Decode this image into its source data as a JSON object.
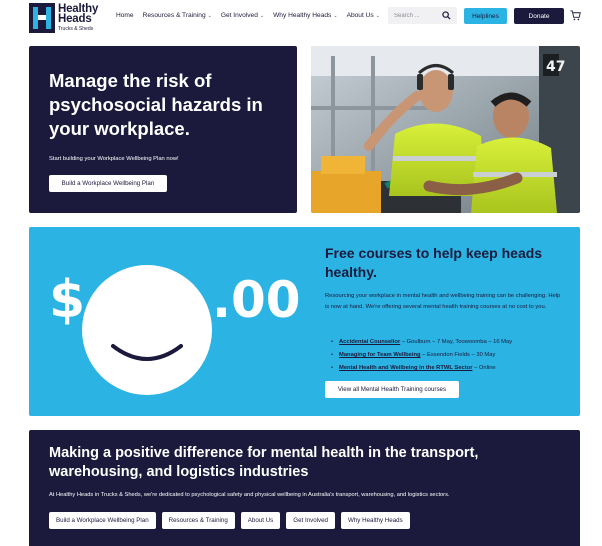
{
  "brand": {
    "name_line1": "Healthy",
    "name_line2": "Heads",
    "tagline": "Trucks & Sheds",
    "colors": {
      "navy": "#1b1a3c",
      "cyan": "#2bb3e3",
      "white": "#ffffff"
    }
  },
  "nav": {
    "items": [
      {
        "label": "Home",
        "has_dropdown": false
      },
      {
        "label": "Resources & Training",
        "has_dropdown": true
      },
      {
        "label": "Get Involved",
        "has_dropdown": true
      },
      {
        "label": "Why Healthy Heads",
        "has_dropdown": true
      },
      {
        "label": "About Us",
        "has_dropdown": true
      }
    ],
    "search_placeholder": "Search ...",
    "helplines_label": "Helplines",
    "donate_label": "Donate",
    "icons": {
      "search": "search-icon",
      "cart": "cart-icon",
      "dropdown": "chevron-down-icon"
    }
  },
  "hero": {
    "title": "Manage the risk of psychosocial hazards in your workplace.",
    "subtitle": "Start building your Workplace Wellbeing Plan now!",
    "button_label": "Build a Workplace Wellbeing Plan",
    "photo_sign": "47"
  },
  "courses": {
    "graphic": {
      "dollar": "$",
      "cents": ".00"
    },
    "title": "Free courses to help keep heads healthy.",
    "text": "Resourcing your workplace in mental health and wellbeing training can be challenging. Help is now at hand. We're offering several mental health training courses at no cost to you.",
    "items": [
      {
        "link": "Accidental Counsellor",
        "detail": " – Goulburn – 7 May, Toowoomba – 16 May"
      },
      {
        "link": "Managing for Team Wellbeing",
        "detail": " – Essendon Fields – 30 May"
      },
      {
        "link": "Mental Health and Wellbeing in the RTWL Sector",
        "detail": " – Online"
      }
    ],
    "button_label": "View all Mental Health Training courses"
  },
  "mission": {
    "title": "Making a positive difference for mental health in the transport, warehousing, and logistics industries",
    "text": "At Healthy Heads in Trucks & Sheds, we're dedicated to psychological safety and physical wellbeing in Australia's transport, warehousing, and logistics sectors.",
    "buttons": [
      "Build a Workplace Wellbeing Plan",
      "Resources & Training",
      "About Us",
      "Get Involved",
      "Why Healthy Heads"
    ]
  }
}
